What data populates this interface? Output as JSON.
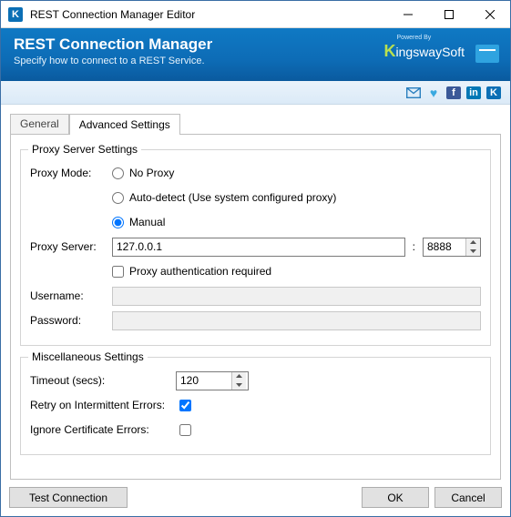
{
  "window": {
    "title": "REST Connection Manager Editor"
  },
  "banner": {
    "title": "REST Connection Manager",
    "subtitle": "Specify how to connect to a REST Service.",
    "brand_powered": "Powered By",
    "brand_name": "ingswaySoft"
  },
  "tabs": {
    "general": "General",
    "advanced": "Advanced Settings"
  },
  "proxy": {
    "group_title": "Proxy Server Settings",
    "mode_label": "Proxy Mode:",
    "no_proxy": "No Proxy",
    "auto_detect": "Auto-detect (Use system configured proxy)",
    "manual": "Manual",
    "selected": "manual",
    "server_label": "Proxy Server:",
    "server_value": "127.0.0.1",
    "port_sep": ":",
    "port_value": "8888",
    "auth_label": "Proxy authentication required",
    "username_label": "Username:",
    "password_label": "Password:"
  },
  "misc": {
    "group_title": "Miscellaneous Settings",
    "timeout_label": "Timeout (secs):",
    "timeout_value": "120",
    "retry_label": "Retry on Intermittent Errors:",
    "retry_checked": true,
    "ignore_label": "Ignore Certificate Errors:",
    "ignore_checked": false
  },
  "buttons": {
    "test": "Test Connection",
    "ok": "OK",
    "cancel": "Cancel"
  }
}
